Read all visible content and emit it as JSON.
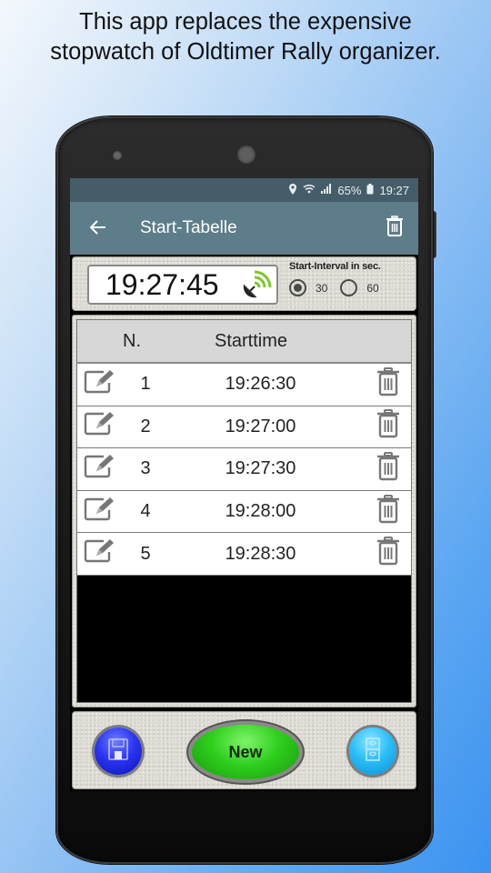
{
  "promo": {
    "line1": "This app replaces the expensive",
    "line2": "stopwatch of Oldtimer Rally organizer."
  },
  "status_bar": {
    "icons": [
      "location-icon",
      "wifi-icon",
      "signal-icon"
    ],
    "battery": "65%",
    "battery_icon": "battery-icon",
    "time": "19:27"
  },
  "app_bar": {
    "back_icon": "arrow-left-icon",
    "title": "Start-Tabelle",
    "action_icon": "trash-icon",
    "color": "#5e7d8b"
  },
  "clock": {
    "time": "19:27:45",
    "icon": "satellite-dish-icon"
  },
  "interval": {
    "label": "Start-Interval in sec.",
    "options": [
      {
        "label": "30",
        "selected": true
      },
      {
        "label": "60",
        "selected": false
      }
    ]
  },
  "table": {
    "headers": {
      "number": "N.",
      "starttime": "Starttime"
    },
    "rows": [
      {
        "n": "1",
        "time": "19:26:30"
      },
      {
        "n": "2",
        "time": "19:27:00"
      },
      {
        "n": "3",
        "time": "19:27:30"
      },
      {
        "n": "4",
        "time": "19:28:00"
      },
      {
        "n": "5",
        "time": "19:28:30"
      }
    ]
  },
  "bottom": {
    "save_icon": "floppy-disk-icon",
    "new_label": "New",
    "archive_icon": "file-cabinet-icon"
  }
}
